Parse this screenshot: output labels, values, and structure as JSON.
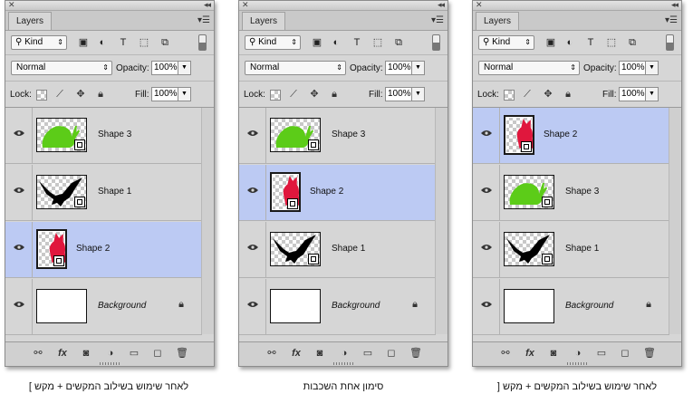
{
  "panels": [
    {
      "tab": "Layers",
      "kind_label": "Kind",
      "blend_mode": "Normal",
      "opacity_label": "Opacity:",
      "opacity_value": "100%",
      "lock_label": "Lock:",
      "fill_label": "Fill:",
      "fill_value": "100%",
      "layers": [
        {
          "name": "Shape 3",
          "shape": "snail-green",
          "selected": false
        },
        {
          "name": "Shape 1",
          "shape": "bird-black",
          "selected": false
        },
        {
          "name": "Shape 2",
          "shape": "cat-red",
          "selected": true
        },
        {
          "name": "Background",
          "shape": "white",
          "selected": false,
          "locked": true
        }
      ]
    },
    {
      "tab": "Layers",
      "kind_label": "Kind",
      "blend_mode": "Normal",
      "opacity_label": "Opacity:",
      "opacity_value": "100%",
      "lock_label": "Lock:",
      "fill_label": "Fill:",
      "fill_value": "100%",
      "layers": [
        {
          "name": "Shape 3",
          "shape": "snail-green",
          "selected": false
        },
        {
          "name": "Shape 2",
          "shape": "cat-red",
          "selected": true
        },
        {
          "name": "Shape 1",
          "shape": "bird-black",
          "selected": false
        },
        {
          "name": "Background",
          "shape": "white",
          "selected": false,
          "locked": true
        }
      ]
    },
    {
      "tab": "Layers",
      "kind_label": "Kind",
      "blend_mode": "Normal",
      "opacity_label": "Opacity:",
      "opacity_value": "100%",
      "lock_label": "Lock:",
      "fill_label": "Fill:",
      "fill_value": "100%",
      "layers": [
        {
          "name": "Shape 2",
          "shape": "cat-red",
          "selected": true
        },
        {
          "name": "Shape 3",
          "shape": "snail-green",
          "selected": false
        },
        {
          "name": "Shape 1",
          "shape": "bird-black",
          "selected": false
        },
        {
          "name": "Background",
          "shape": "white",
          "selected": false,
          "locked": true
        }
      ]
    }
  ],
  "captions": {
    "left": "לאחר שימוש בשילוב המקשים + מקש ]",
    "middle": "סימון אחת השכבות",
    "right": "לאחר שימוש בשילוב המקשים + מקש ["
  },
  "colors": {
    "selected_row": "#bccaf3",
    "green_shape": "#5ccc18",
    "red_shape": "#e0173d"
  }
}
